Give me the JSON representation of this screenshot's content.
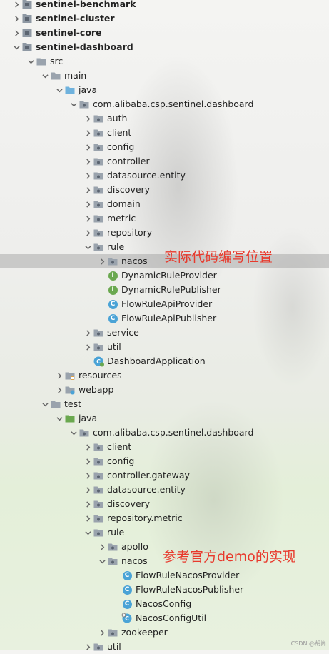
{
  "tree": [
    {
      "label": "sentinel-benchmark",
      "level": 0,
      "expanded": false,
      "icon": "module",
      "bold": true
    },
    {
      "label": "sentinel-cluster",
      "level": 0,
      "expanded": false,
      "icon": "module",
      "bold": true
    },
    {
      "label": "sentinel-core",
      "level": 0,
      "expanded": false,
      "icon": "module",
      "bold": true
    },
    {
      "label": "sentinel-dashboard",
      "level": 0,
      "expanded": true,
      "icon": "module",
      "bold": true
    },
    {
      "label": "src",
      "level": 1,
      "expanded": true,
      "icon": "folder"
    },
    {
      "label": "main",
      "level": 2,
      "expanded": true,
      "icon": "folder"
    },
    {
      "label": "java",
      "level": 3,
      "expanded": true,
      "icon": "source-root"
    },
    {
      "label": "com.alibaba.csp.sentinel.dashboard",
      "level": 4,
      "expanded": true,
      "icon": "package"
    },
    {
      "label": "auth",
      "level": 5,
      "expanded": false,
      "icon": "package"
    },
    {
      "label": "client",
      "level": 5,
      "expanded": false,
      "icon": "package"
    },
    {
      "label": "config",
      "level": 5,
      "expanded": false,
      "icon": "package"
    },
    {
      "label": "controller",
      "level": 5,
      "expanded": false,
      "icon": "package"
    },
    {
      "label": "datasource.entity",
      "level": 5,
      "expanded": false,
      "icon": "package"
    },
    {
      "label": "discovery",
      "level": 5,
      "expanded": false,
      "icon": "package"
    },
    {
      "label": "domain",
      "level": 5,
      "expanded": false,
      "icon": "package"
    },
    {
      "label": "metric",
      "level": 5,
      "expanded": false,
      "icon": "package"
    },
    {
      "label": "repository",
      "level": 5,
      "expanded": false,
      "icon": "package"
    },
    {
      "label": "rule",
      "level": 5,
      "expanded": true,
      "icon": "package"
    },
    {
      "label": "nacos",
      "level": 6,
      "expanded": false,
      "icon": "package",
      "selected": true
    },
    {
      "label": "DynamicRuleProvider",
      "level": 6,
      "icon": "interface"
    },
    {
      "label": "DynamicRulePublisher",
      "level": 6,
      "icon": "interface"
    },
    {
      "label": "FlowRuleApiProvider",
      "level": 6,
      "icon": "class"
    },
    {
      "label": "FlowRuleApiPublisher",
      "level": 6,
      "icon": "class"
    },
    {
      "label": "service",
      "level": 5,
      "expanded": false,
      "icon": "package"
    },
    {
      "label": "util",
      "level": 5,
      "expanded": false,
      "icon": "package"
    },
    {
      "label": "DashboardApplication",
      "level": 5,
      "icon": "spring-class"
    },
    {
      "label": "resources",
      "level": 3,
      "expanded": false,
      "icon": "resources"
    },
    {
      "label": "webapp",
      "level": 3,
      "expanded": false,
      "icon": "web"
    },
    {
      "label": "test",
      "level": 2,
      "expanded": true,
      "icon": "folder"
    },
    {
      "label": "java",
      "level": 3,
      "expanded": true,
      "icon": "test-root"
    },
    {
      "label": "com.alibaba.csp.sentinel.dashboard",
      "level": 4,
      "expanded": true,
      "icon": "package"
    },
    {
      "label": "client",
      "level": 5,
      "expanded": false,
      "icon": "package"
    },
    {
      "label": "config",
      "level": 5,
      "expanded": false,
      "icon": "package"
    },
    {
      "label": "controller.gateway",
      "level": 5,
      "expanded": false,
      "icon": "package"
    },
    {
      "label": "datasource.entity",
      "level": 5,
      "expanded": false,
      "icon": "package"
    },
    {
      "label": "discovery",
      "level": 5,
      "expanded": false,
      "icon": "package"
    },
    {
      "label": "repository.metric",
      "level": 5,
      "expanded": false,
      "icon": "package"
    },
    {
      "label": "rule",
      "level": 5,
      "expanded": true,
      "icon": "package"
    },
    {
      "label": "apollo",
      "level": 6,
      "expanded": false,
      "icon": "package"
    },
    {
      "label": "nacos",
      "level": 6,
      "expanded": true,
      "icon": "package"
    },
    {
      "label": "FlowRuleNacosProvider",
      "level": 7,
      "icon": "class"
    },
    {
      "label": "FlowRuleNacosPublisher",
      "level": 7,
      "icon": "class"
    },
    {
      "label": "NacosConfig",
      "level": 7,
      "icon": "class"
    },
    {
      "label": "NacosConfigUtil",
      "level": 7,
      "icon": "config-class"
    },
    {
      "label": "zookeeper",
      "level": 6,
      "expanded": false,
      "icon": "package"
    },
    {
      "label": "util",
      "level": 5,
      "expanded": false,
      "icon": "package"
    }
  ],
  "annotations": {
    "actual_code_location": "实际代码编写位置",
    "official_demo": "参考官方demo的实现"
  },
  "watermark": "CSDN @胡尚",
  "colors": {
    "annotation_red": "#e8392c",
    "folder_gray": "#9aa3ad",
    "source_root_blue": "#6fb2dd",
    "test_root_green": "#6aa84f",
    "class_badge": "#4aa3d6",
    "interface_badge": "#6aa84f"
  }
}
